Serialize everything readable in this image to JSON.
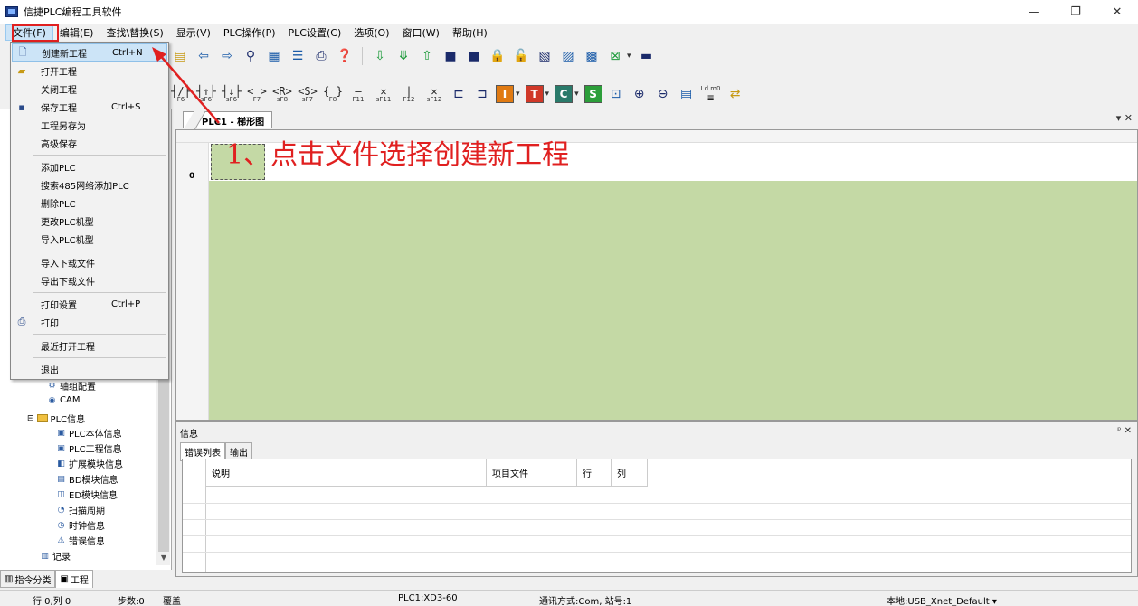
{
  "window": {
    "title": "信捷PLC编程工具软件",
    "minimize": "—",
    "restore": "❐",
    "close": "✕"
  },
  "menubar": [
    "文件(F)",
    "编辑(E)",
    "查找\\替换(S)",
    "显示(V)",
    "PLC操作(P)",
    "PLC设置(C)",
    "选项(O)",
    "窗口(W)",
    "帮助(H)"
  ],
  "file_menu": {
    "items": [
      {
        "label": "创建新工程",
        "shortcut": "Ctrl+N",
        "icon": "new-file-icon"
      },
      {
        "label": "打开工程",
        "shortcut": "",
        "icon": "open-folder-icon"
      },
      {
        "label": "关闭工程",
        "shortcut": "",
        "icon": ""
      },
      {
        "label": "保存工程",
        "shortcut": "Ctrl+S",
        "icon": "save-icon"
      },
      {
        "label": "工程另存为",
        "shortcut": "",
        "icon": ""
      },
      {
        "label": "高级保存",
        "shortcut": "",
        "icon": ""
      },
      {
        "label": "添加PLC",
        "shortcut": "",
        "icon": ""
      },
      {
        "label": "搜索485网络添加PLC",
        "shortcut": "",
        "icon": ""
      },
      {
        "label": "删除PLC",
        "shortcut": "",
        "icon": ""
      },
      {
        "label": "更改PLC机型",
        "shortcut": "",
        "icon": ""
      },
      {
        "label": "导入PLC机型",
        "shortcut": "",
        "icon": ""
      },
      {
        "label": "导入下载文件",
        "shortcut": "",
        "icon": ""
      },
      {
        "label": "导出下载文件",
        "shortcut": "",
        "icon": ""
      },
      {
        "label": "打印设置",
        "shortcut": "Ctrl+P",
        "icon": ""
      },
      {
        "label": "打印",
        "shortcut": "",
        "icon": "print-icon"
      },
      {
        "label": "最近打开工程",
        "shortcut": "",
        "icon": ""
      },
      {
        "label": "退出",
        "shortcut": "",
        "icon": ""
      }
    ]
  },
  "toolbar2_keys": [
    "F6",
    "sF6",
    "sF6",
    "F7",
    "sF8",
    "sF7",
    "F8",
    "F11",
    "sF11",
    "F12",
    "sF12"
  ],
  "toolbar2_letters": [
    "I",
    "T",
    "C",
    "S"
  ],
  "toolbar2_ldm": "Ld m0",
  "tree": {
    "items": [
      {
        "label": "轴组配置",
        "indent": 2
      },
      {
        "label": "CAM",
        "indent": 2
      },
      {
        "label": "PLC信息",
        "indent": 1
      },
      {
        "label": "PLC本体信息",
        "indent": 2
      },
      {
        "label": "PLC工程信息",
        "indent": 2
      },
      {
        "label": "扩展模块信息",
        "indent": 2
      },
      {
        "label": "BD模块信息",
        "indent": 2
      },
      {
        "label": "ED模块信息",
        "indent": 2
      },
      {
        "label": "扫描周期",
        "indent": 2
      },
      {
        "label": "时钟信息",
        "indent": 2
      },
      {
        "label": "错误信息",
        "indent": 2
      },
      {
        "label": "记录",
        "indent": 1
      }
    ]
  },
  "left_tabs": [
    "指令分类",
    "工程"
  ],
  "document": {
    "tab_label": "PLC1 - 梯形图",
    "rung_number": "0",
    "controls": "▾ ✕"
  },
  "annotation": "1、点击文件选择创建新工程",
  "info_panel": {
    "title": "信息",
    "controls": "ᵖ ✕",
    "tabs": [
      "错误列表",
      "输出"
    ],
    "columns": [
      "说明",
      "项目文件",
      "行",
      "列"
    ]
  },
  "statusbar": {
    "position": "行 0,列 0",
    "steps": "步数:0",
    "mode": "覆盖",
    "plc": "PLC1:XD3-60",
    "comm": "通讯方式:Com, 站号:1",
    "local": "本地:USB_Xnet_Default ▾"
  },
  "colors": {
    "ladder_bg": "#c4d9a5",
    "annotation": "#e02020",
    "menu_highlight": "#cce4f7"
  }
}
